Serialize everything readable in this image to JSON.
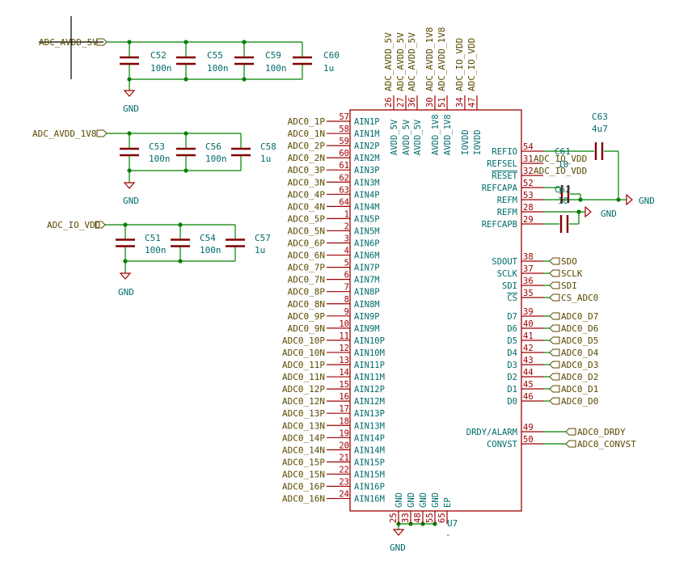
{
  "power": {
    "avdd5": "ADC_AVDD_5V",
    "avdd18": "ADC_AVDD_1V8",
    "iovdd": "ADC_IO_VDD",
    "gnd": "GND"
  },
  "caps": [
    {
      "ref": "C52",
      "val": "100n"
    },
    {
      "ref": "C55",
      "val": "100n"
    },
    {
      "ref": "C59",
      "val": "100n"
    },
    {
      "ref": "C60",
      "val": "1u"
    },
    {
      "ref": "C53",
      "val": "100n"
    },
    {
      "ref": "C56",
      "val": "100n"
    },
    {
      "ref": "C58",
      "val": "1u"
    },
    {
      "ref": "C51",
      "val": "100n"
    },
    {
      "ref": "C54",
      "val": "100n"
    },
    {
      "ref": "C57",
      "val": "1u"
    },
    {
      "ref": "C63",
      "val": "4u7"
    },
    {
      "ref": "C61",
      "val": "10"
    },
    {
      "ref": "C62",
      "val": "10"
    }
  ],
  "top_pins": [
    {
      "num": "26",
      "net": "ADC_AVDD_5V",
      "name": "AVDD_5V"
    },
    {
      "num": "27",
      "net": "ADC_AVDD_5V",
      "name": "AVDD_5V"
    },
    {
      "num": "36",
      "net": "ADC_AVDD_5V",
      "name": "AVDD_5V"
    },
    {
      "num": "30",
      "net": "ADC_AVDD_1V8",
      "name": "AVDD_1V8"
    },
    {
      "num": "51",
      "net": "ADC_AVDD_1V8",
      "name": "AVDD_1V8"
    },
    {
      "num": "34",
      "net": "ADC_IO_VDD",
      "name": "IOVDD"
    },
    {
      "num": "47",
      "net": "ADC_IO_VDD",
      "name": "IOVDD"
    }
  ],
  "left_pins": [
    {
      "net": "ADC0_1P",
      "num": "57",
      "name": "AIN1P"
    },
    {
      "net": "ADC0_1N",
      "num": "58",
      "name": "AIN1M"
    },
    {
      "net": "ADC0_2P",
      "num": "59",
      "name": "AIN2P"
    },
    {
      "net": "ADC0_2N",
      "num": "60",
      "name": "AIN2M"
    },
    {
      "net": "ADC0_3P",
      "num": "61",
      "name": "AIN3P"
    },
    {
      "net": "ADC0_3N",
      "num": "62",
      "name": "AIN3M"
    },
    {
      "net": "ADC0_4P",
      "num": "63",
      "name": "AIN4P"
    },
    {
      "net": "ADC0_4N",
      "num": "64",
      "name": "AIN4M"
    },
    {
      "net": "ADC0_5P",
      "num": "1",
      "name": "AIN5P"
    },
    {
      "net": "ADC0_5N",
      "num": "2",
      "name": "AIN5M"
    },
    {
      "net": "ADC0_6P",
      "num": "3",
      "name": "AIN6P"
    },
    {
      "net": "ADC0_6N",
      "num": "4",
      "name": "AIN6M"
    },
    {
      "net": "ADC0_7P",
      "num": "5",
      "name": "AIN7P"
    },
    {
      "net": "ADC0_7N",
      "num": "6",
      "name": "AIN7M"
    },
    {
      "net": "ADC0_8P",
      "num": "7",
      "name": "AIN8P"
    },
    {
      "net": "ADC0_8N",
      "num": "8",
      "name": "AIN8M"
    },
    {
      "net": "ADC0_9P",
      "num": "9",
      "name": "AIN9P"
    },
    {
      "net": "ADC0_9N",
      "num": "10",
      "name": "AIN9M"
    },
    {
      "net": "ADC0_10P",
      "num": "11",
      "name": "AIN10P"
    },
    {
      "net": "ADC0_10N",
      "num": "12",
      "name": "AIN10M"
    },
    {
      "net": "ADC0_11P",
      "num": "13",
      "name": "AIN11P"
    },
    {
      "net": "ADC0_11N",
      "num": "14",
      "name": "AIN11M"
    },
    {
      "net": "ADC0_12P",
      "num": "15",
      "name": "AIN12P"
    },
    {
      "net": "ADC0_12N",
      "num": "16",
      "name": "AIN12M"
    },
    {
      "net": "ADC0_13P",
      "num": "17",
      "name": "AIN13P"
    },
    {
      "net": "ADC0_13N",
      "num": "18",
      "name": "AIN13M"
    },
    {
      "net": "ADC0_14P",
      "num": "19",
      "name": "AIN14P"
    },
    {
      "net": "ADC0_14N",
      "num": "20",
      "name": "AIN14M"
    },
    {
      "net": "ADC0_15P",
      "num": "21",
      "name": "AIN15P"
    },
    {
      "net": "ADC0_15N",
      "num": "22",
      "name": "AIN15M"
    },
    {
      "net": "ADC0_16P",
      "num": "23",
      "name": "AIN16P"
    },
    {
      "net": "ADC0_16N",
      "num": "24",
      "name": "AIN16M"
    }
  ],
  "right_pins": [
    {
      "name": "REFIO",
      "num": "54"
    },
    {
      "name": "REFSEL",
      "num": "31",
      "net": "ADC_IO_VDD"
    },
    {
      "name": "RESET",
      "num": "32",
      "net": "ADC_IO_VDD",
      "overbar": true
    },
    {
      "name": "REFCAPA",
      "num": "52"
    },
    {
      "name": "REFM",
      "num": "53"
    },
    {
      "name": "REFM",
      "num": "28"
    },
    {
      "name": "REFCAPB",
      "num": "29"
    },
    {
      "name": "SDOUT",
      "num": "38",
      "net": "SDO"
    },
    {
      "name": "SCLK",
      "num": "37",
      "net": "SCLK"
    },
    {
      "name": "SDI",
      "num": "36",
      "net": "SDI"
    },
    {
      "name": "CS",
      "num": "35",
      "net": "CS_ADC0",
      "overbar": true
    },
    {
      "name": "D7",
      "num": "39",
      "net": "ADC0_D7"
    },
    {
      "name": "D6",
      "num": "40",
      "net": "ADC0_D6"
    },
    {
      "name": "D5",
      "num": "41",
      "net": "ADC0_D5"
    },
    {
      "name": "D4",
      "num": "42",
      "net": "ADC0_D4"
    },
    {
      "name": "D3",
      "num": "43",
      "net": "ADC0_D3"
    },
    {
      "name": "D2",
      "num": "44",
      "net": "ADC0_D2"
    },
    {
      "name": "D1",
      "num": "45",
      "net": "ADC0_D1"
    },
    {
      "name": "D0",
      "num": "46",
      "net": "ADC0_D0"
    },
    {
      "name": "DRDY/ALARM",
      "num": "49",
      "net": "ADC0_DRDY"
    },
    {
      "name": "CONVST",
      "num": "50",
      "net": "ADC0_CONVST"
    }
  ],
  "bottom_pins": [
    {
      "num": "25",
      "name": "GND"
    },
    {
      "num": "33",
      "name": "GND"
    },
    {
      "num": "48",
      "name": "GND"
    },
    {
      "num": "55",
      "name": "GND"
    },
    {
      "num": "65",
      "name": "EP"
    }
  ],
  "chip_ref": "U7",
  "chip_value": "-",
  "colors": {
    "wire": "#008000",
    "body": "#a00000",
    "cap": "#800000",
    "net": "#5a4a00",
    "name": "#006b6b"
  }
}
